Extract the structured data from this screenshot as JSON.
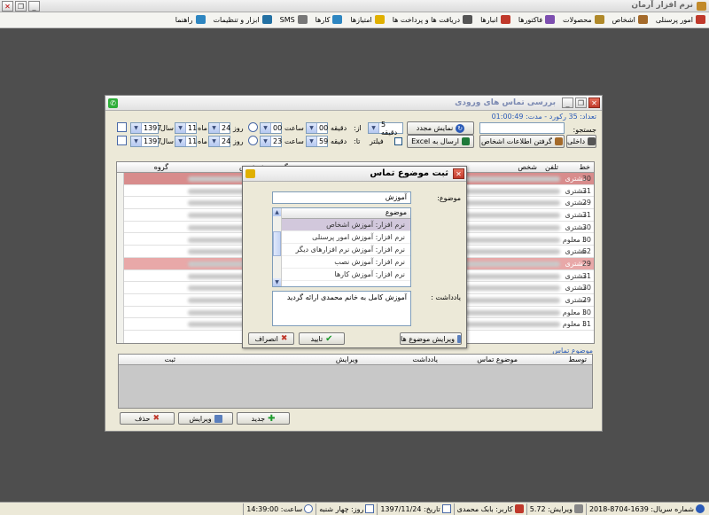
{
  "app": {
    "title": "نرم افزار آرمان"
  },
  "menu": {
    "items": [
      {
        "label": "امور پرسنلی",
        "icon": "users-icon",
        "color": "#c0392b"
      },
      {
        "label": "اشخاص",
        "icon": "person-icon",
        "color": "#a46a2a"
      },
      {
        "label": "محصولات",
        "icon": "box-icon",
        "color": "#b0892a"
      },
      {
        "label": "فاکتورها",
        "icon": "invoice-icon",
        "color": "#7d4fb0"
      },
      {
        "label": "انبارها",
        "icon": "warehouse-icon",
        "color": "#c0392b"
      },
      {
        "label": "دریافت ها و پرداخت ها",
        "icon": "money-icon",
        "color": "#555"
      },
      {
        "label": "امتیازها",
        "icon": "star-icon",
        "color": "#e0b000"
      },
      {
        "label": "کارها",
        "icon": "tasks-icon",
        "color": "#2e86c1"
      },
      {
        "label": "SMS",
        "icon": "sms-icon",
        "color": "#777"
      },
      {
        "label": "ابزار و تنظیمات",
        "icon": "tools-icon",
        "color": "#2471a3"
      },
      {
        "label": "راهنما",
        "icon": "help-icon",
        "color": "#2e86c1"
      }
    ]
  },
  "calls": {
    "title": "بررسی تماس های ورودی",
    "summary": "تعداد: 35 رکورد - مدت: 01:00:49",
    "search_label": "جستجو:",
    "refresh_label": "نمایش مجدد",
    "interval_value": "5 دقیقه",
    "from_label": "از:",
    "to_label": "تا:",
    "minute_label": "دقیقه",
    "hour_label": "ساعت",
    "day_label": "روز",
    "month_label": "ماه",
    "year_label": "سال",
    "from": {
      "minute": "00",
      "hour": "00",
      "day": "24",
      "month": "11",
      "year": "1397"
    },
    "to": {
      "minute": "59",
      "hour": "23",
      "day": "24",
      "month": "11",
      "year": "1397"
    },
    "filter_label": "فیلتر",
    "excel_label": "ارسال به Excel",
    "get_info_label": "گرفتن اطلاعات اشخاص",
    "internal_label": "داخلی",
    "columns": {
      "khat": "خط",
      "phone": "تلفن",
      "person": "شخص",
      "followup": "پیگیری پیش فرض",
      "group": "گروه"
    },
    "rows": [
      {
        "khat": "30",
        "group": "مشتری",
        "highlight": "selected"
      },
      {
        "khat": "31",
        "group": "مشتری",
        "highlight": ""
      },
      {
        "khat": "29",
        "group": "مشتری",
        "highlight": ""
      },
      {
        "khat": "31",
        "group": "مشتری",
        "highlight": ""
      },
      {
        "khat": "30",
        "group": "مشتری",
        "highlight": ""
      },
      {
        "khat": "30",
        "group": "نا معلوم",
        "highlight": ""
      },
      {
        "khat": "62",
        "group": "مشتری",
        "highlight": ""
      },
      {
        "khat": "29",
        "group": "مشتری",
        "highlight": "pink"
      },
      {
        "khat": "31",
        "group": "مشتری",
        "highlight": ""
      },
      {
        "khat": "30",
        "group": "مشتری",
        "highlight": ""
      },
      {
        "khat": "29",
        "group": "مشتری",
        "highlight": ""
      },
      {
        "khat": "30",
        "group": "نا معلوم",
        "highlight": ""
      },
      {
        "khat": "31",
        "group": "نا معلوم",
        "highlight": ""
      }
    ],
    "subject_section_label": "موضوع تماس",
    "subject_columns": {
      "by": "توسط",
      "subject": "موضوع تماس",
      "note": "یادداشت",
      "edit": "ویرایش",
      "save": "ثبت"
    },
    "new_label": "جدید",
    "edit_label": "ویرایش",
    "delete_label": "حذف"
  },
  "dialog": {
    "title": "ثبت موضوع تماس",
    "subject_label": "موضوع:",
    "subject_value": "آموزش",
    "list_header": "موضوع",
    "list_items": [
      "نرم افزار: آموزش اشخاص",
      "نرم افزار: آموزش امور پرسنلی",
      "نرم افزار: آموزش نرم افزارهای دیگر",
      "نرم افزار: آموزش نصب",
      "نرم افزار: آموزش کارها"
    ],
    "note_label": "یادداشت :",
    "note_value": "آموزش کامل به خانم محمدی ارائه گردید",
    "edit_subjects_label": "ویرایش موضوع ها",
    "ok_label": "تایید",
    "cancel_label": "انصراف"
  },
  "status": {
    "serial": "شماره سریال: 1639-8704-2018",
    "version": "ویرایش: 5.72",
    "user": "کاربر: بابک محمدی",
    "date": "تاریخ: 1397/11/24",
    "weekday": "روز: چهار شنبه",
    "time": "ساعت: 14:39:00"
  },
  "colors": {
    "accent": "#2b5bb8",
    "selected_row": "#d88c8c",
    "pink_row": "#e8a8a8",
    "title_text": "#7c8ab2"
  }
}
